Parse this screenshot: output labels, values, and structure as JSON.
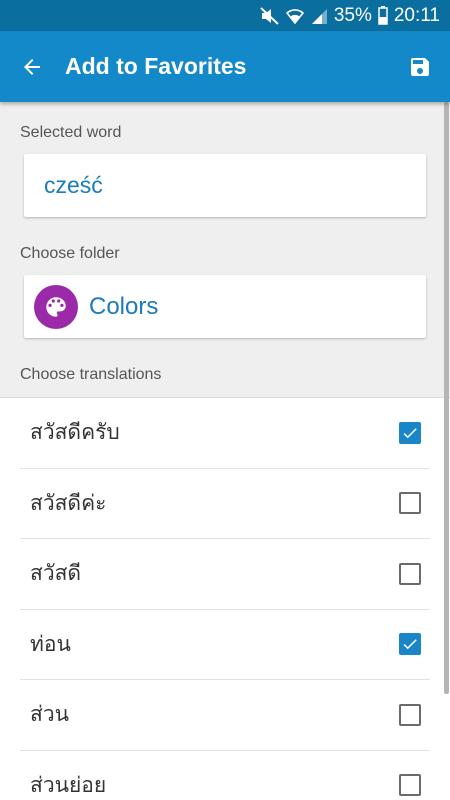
{
  "status_bar": {
    "battery": "35%",
    "time": "20:11",
    "icons": [
      "mute-icon",
      "wifi-icon",
      "signal-icon",
      "battery-icon"
    ]
  },
  "app_bar": {
    "title": "Add to Favorites",
    "back_icon": "arrow-left-icon",
    "save_icon": "save-icon"
  },
  "selected_word": {
    "label": "Selected word",
    "value": "cześć"
  },
  "folder": {
    "label": "Choose folder",
    "name": "Colors",
    "icon": "palette-icon",
    "icon_color": "#9b2aa8"
  },
  "translations": {
    "label": "Choose translations",
    "items": [
      {
        "text": "สวัสดีครับ",
        "checked": true
      },
      {
        "text": "สวัสดีค่ะ",
        "checked": false
      },
      {
        "text": "สวัสดี",
        "checked": false
      },
      {
        "text": "ท่อน",
        "checked": true
      },
      {
        "text": "ส่วน",
        "checked": false
      },
      {
        "text": "ส่วนย่อย",
        "checked": false
      }
    ]
  },
  "colors": {
    "primary": "#1389c9",
    "status_bar": "#0a6e9f",
    "accent": "#1a86c8"
  }
}
